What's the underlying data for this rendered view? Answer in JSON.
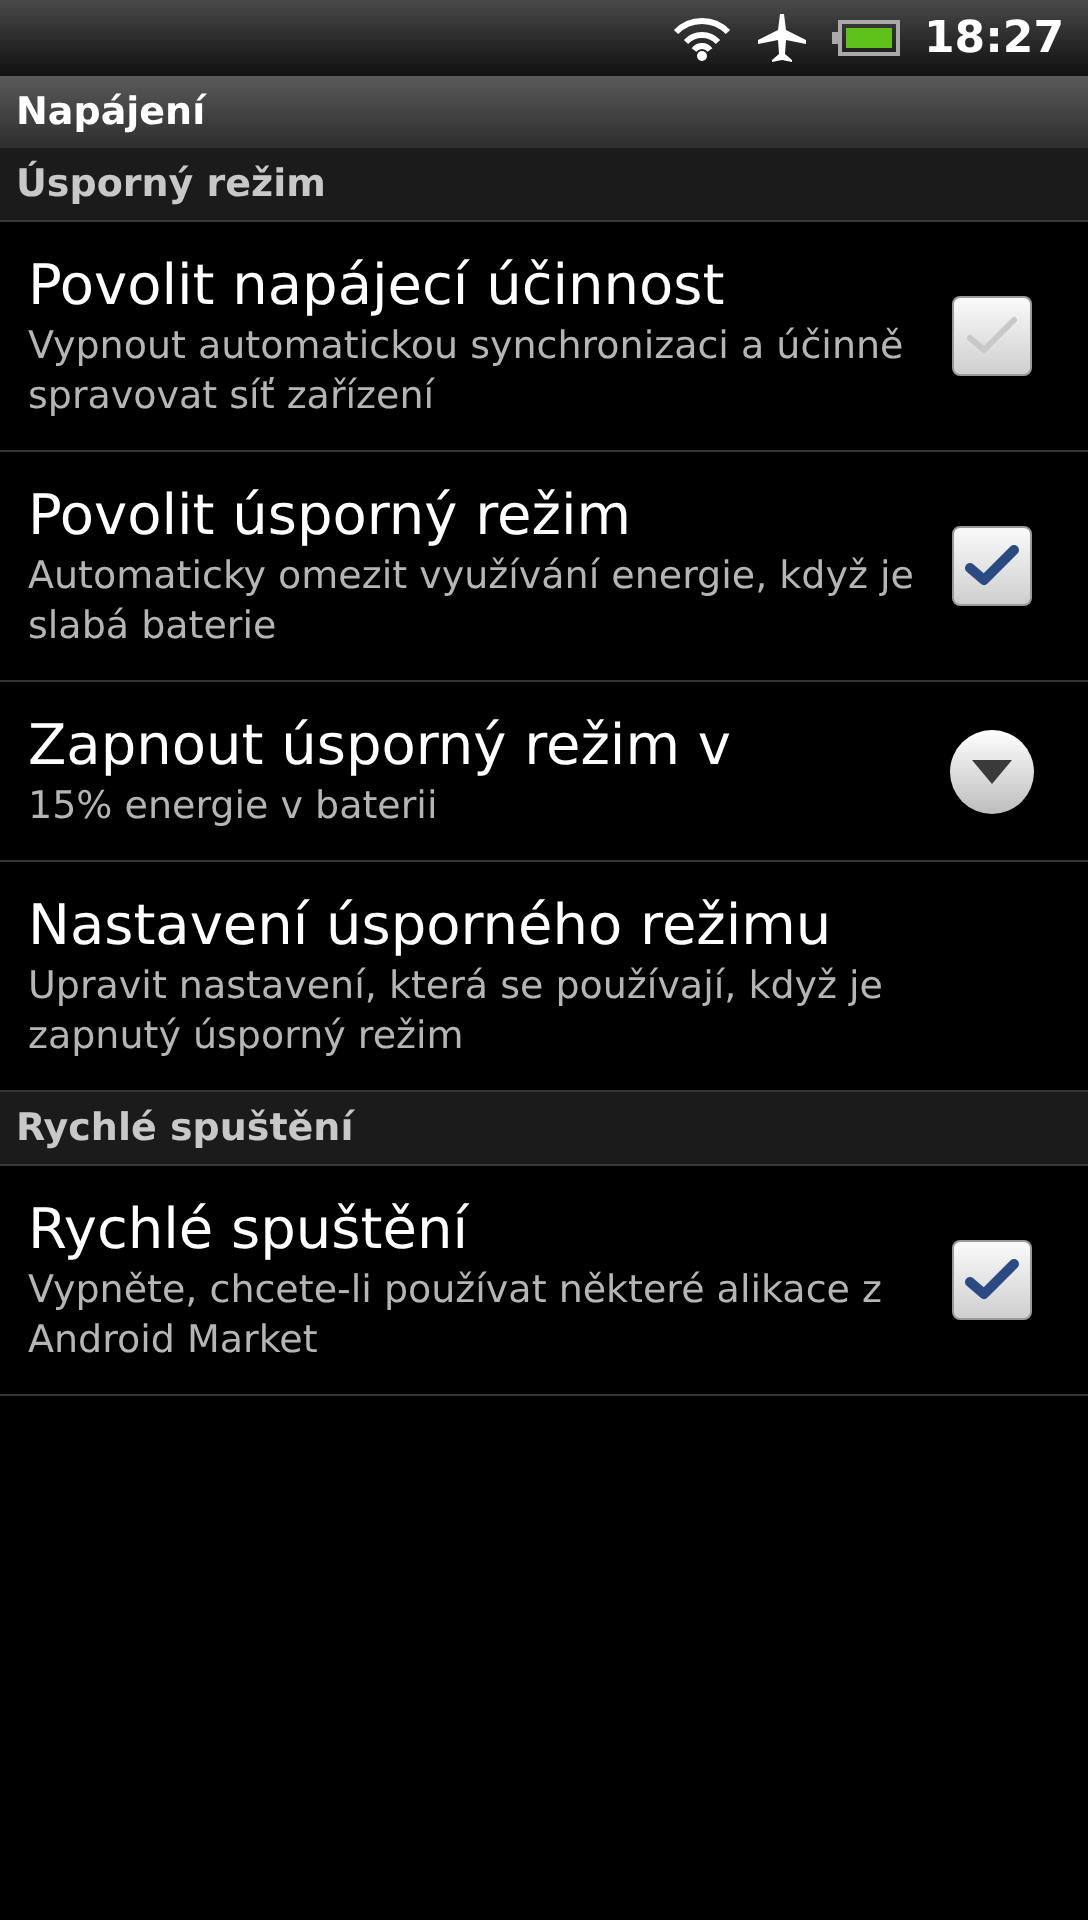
{
  "status_bar": {
    "time": "18:27"
  },
  "title": "Napájení",
  "sections": [
    {
      "header": "Úsporný režim",
      "items": [
        {
          "kind": "checkbox",
          "title": "Povolit napájecí účinnost",
          "summary": "Vypnout automatickou synchronizaci a účinně spravovat síť zařízení",
          "checked": true,
          "disabled": true
        },
        {
          "kind": "checkbox",
          "title": "Povolit úsporný režim",
          "summary": "Automaticky omezit využívání energie, když je slabá baterie",
          "checked": true,
          "disabled": false
        },
        {
          "kind": "dropdown",
          "title": "Zapnout úsporný režim v",
          "summary": "15% energie v baterii"
        },
        {
          "kind": "plain",
          "title": "Nastavení úsporného režimu",
          "summary": "Upravit nastavení, která se používají, když je zapnutý úsporný režim"
        }
      ]
    },
    {
      "header": "Rychlé spuštění",
      "items": [
        {
          "kind": "checkbox",
          "title": "Rychlé spuštění",
          "summary": "Vypněte, chcete-li používat některé alikace z Android Market",
          "checked": true,
          "disabled": false
        }
      ]
    }
  ]
}
